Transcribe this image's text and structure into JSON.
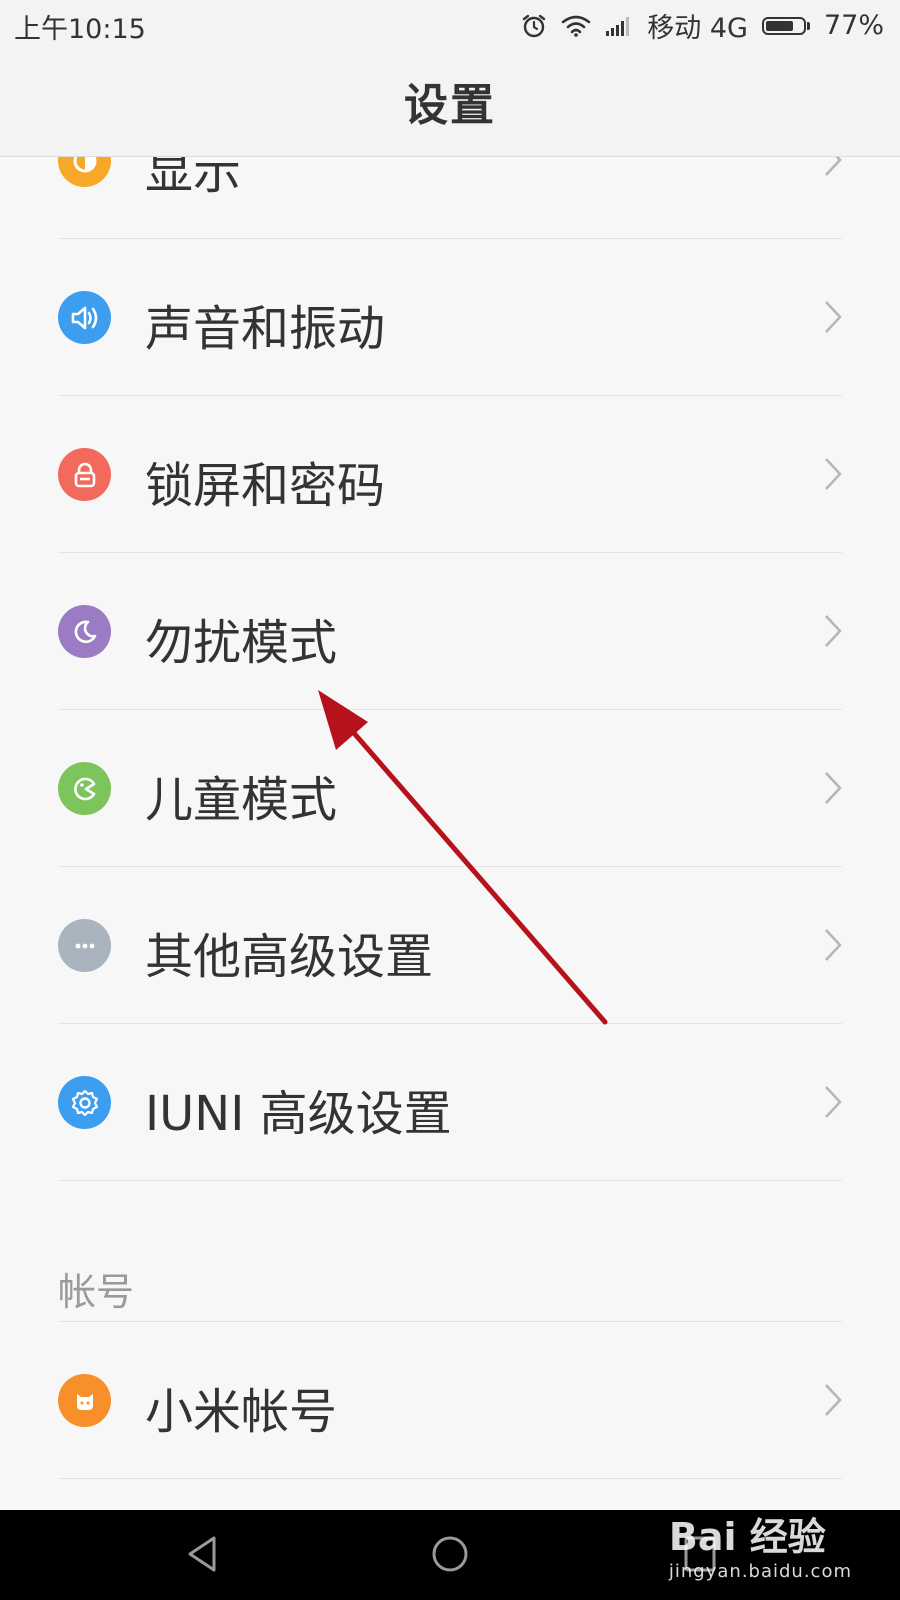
{
  "status_bar": {
    "time": "上午10:15",
    "carrier": "移动 4G",
    "battery_percent": "77%",
    "battery_level": 0.77
  },
  "header": {
    "title": "设置"
  },
  "items": [
    {
      "label": "显示",
      "icon": "display-icon",
      "color": "#f7a829"
    },
    {
      "label": "声音和振动",
      "icon": "speaker-icon",
      "color": "#3d9ef0"
    },
    {
      "label": "锁屏和密码",
      "icon": "lock-icon",
      "color": "#f26a5d"
    },
    {
      "label": "勿扰模式",
      "icon": "moon-icon",
      "color": "#9b7bc4"
    },
    {
      "label": "儿童模式",
      "icon": "child-icon",
      "color": "#7dc45d"
    },
    {
      "label": "其他高级设置",
      "icon": "more-icon",
      "color": "#a9b4bf"
    },
    {
      "label": "IUNI 高级设置",
      "icon": "gear-icon",
      "color": "#3d9ef0"
    }
  ],
  "account_section": {
    "header": "帐号",
    "items": [
      {
        "label": "小米帐号",
        "icon": "mi-account-icon",
        "color": "#f7902a"
      }
    ]
  },
  "watermark": {
    "logo": "Bai 经验",
    "url": "jingyan.baidu.com"
  }
}
